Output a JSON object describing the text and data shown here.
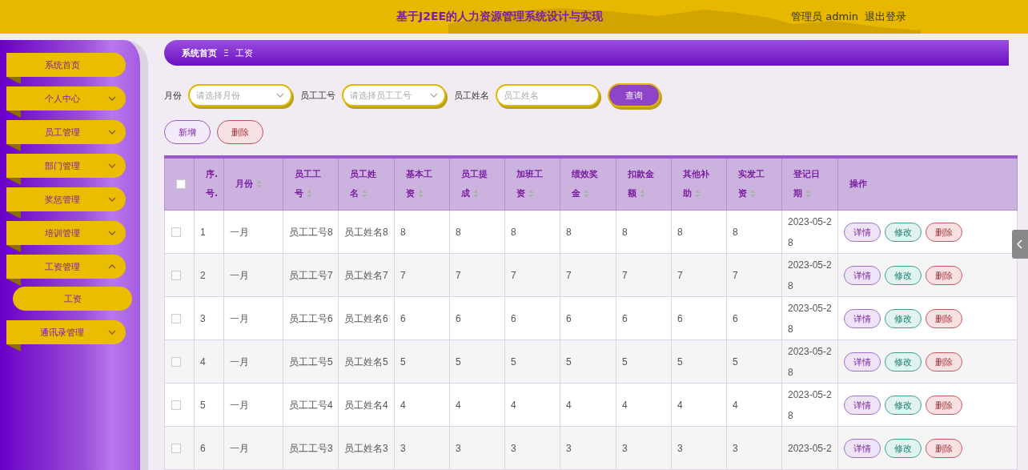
{
  "header": {
    "title": "基于J2EE的人力资源管理系统设计与实现",
    "user": "管理员 admin",
    "logout": "退出登录"
  },
  "sidebar": {
    "items": [
      {
        "label": "系统首页",
        "kind": "link"
      },
      {
        "label": "个人中心",
        "kind": "group",
        "expanded": false
      },
      {
        "label": "员工管理",
        "kind": "group",
        "expanded": false
      },
      {
        "label": "部门管理",
        "kind": "group",
        "expanded": false
      },
      {
        "label": "奖惩管理",
        "kind": "group",
        "expanded": false
      },
      {
        "label": "培训管理",
        "kind": "group",
        "expanded": false
      },
      {
        "label": "工资管理",
        "kind": "group",
        "expanded": true,
        "children": [
          {
            "label": "工资",
            "selected": true
          }
        ]
      },
      {
        "label": "通讯录管理",
        "kind": "group",
        "expanded": false
      }
    ]
  },
  "breadcrumb": [
    "系统首页",
    "工资"
  ],
  "breadcrumb_separator": "Ξ",
  "filters": [
    {
      "label": "月份",
      "placeholder": "请选择月份",
      "kind": "select"
    },
    {
      "label": "员工工号",
      "placeholder": "请选择员工工号",
      "kind": "select"
    },
    {
      "label": "员工姓名",
      "placeholder": "员工姓名",
      "kind": "text"
    }
  ],
  "query_button": "查询",
  "toolbar": [
    {
      "label": "新增",
      "kind": "add"
    },
    {
      "label": "删除",
      "kind": "delete"
    }
  ],
  "table": {
    "select_all": {
      "checked": false
    },
    "columns": [
      {
        "label": "序.号.",
        "sortable": false
      },
      {
        "label": "月份",
        "sortable": true
      },
      {
        "label": "员工工号",
        "sortable": true
      },
      {
        "label": "员工姓名",
        "sortable": true
      },
      {
        "label": "基本工资",
        "sortable": true
      },
      {
        "label": "员工提成",
        "sortable": true
      },
      {
        "label": "加班工资",
        "sortable": true
      },
      {
        "label": "绩效奖金",
        "sortable": true
      },
      {
        "label": "扣款金额",
        "sortable": true
      },
      {
        "label": "其他补助",
        "sortable": true
      },
      {
        "label": "实发工资",
        "sortable": true
      },
      {
        "label": "登记日期",
        "sortable": true
      },
      {
        "label": "操作",
        "sortable": false
      }
    ],
    "rows": [
      {
        "checked": false,
        "cells": [
          "1",
          "一月",
          "员工工号8",
          "员工姓名8",
          "8",
          "8",
          "8",
          "8",
          "8",
          "8",
          "8",
          "2023-05-28"
        ],
        "actions": [
          {
            "label": "详情",
            "kind": "detail"
          },
          {
            "label": "修改",
            "kind": "edit"
          },
          {
            "label": "删除",
            "kind": "delete"
          }
        ]
      },
      {
        "checked": false,
        "cells": [
          "2",
          "一月",
          "员工工号7",
          "员工姓名7",
          "7",
          "7",
          "7",
          "7",
          "7",
          "7",
          "7",
          "2023-05-28"
        ],
        "actions": [
          {
            "label": "详情",
            "kind": "detail"
          },
          {
            "label": "修改",
            "kind": "edit"
          },
          {
            "label": "删除",
            "kind": "delete"
          }
        ]
      },
      {
        "checked": false,
        "cells": [
          "3",
          "一月",
          "员工工号6",
          "员工姓名6",
          "6",
          "6",
          "6",
          "6",
          "6",
          "6",
          "6",
          "2023-05-28"
        ],
        "actions": [
          {
            "label": "详情",
            "kind": "detail"
          },
          {
            "label": "修改",
            "kind": "edit"
          },
          {
            "label": "删除",
            "kind": "delete"
          }
        ]
      },
      {
        "checked": false,
        "cells": [
          "4",
          "一月",
          "员工工号5",
          "员工姓名5",
          "5",
          "5",
          "5",
          "5",
          "5",
          "5",
          "5",
          "2023-05-28"
        ],
        "actions": [
          {
            "label": "详情",
            "kind": "detail"
          },
          {
            "label": "修改",
            "kind": "edit"
          },
          {
            "label": "删除",
            "kind": "delete"
          }
        ]
      },
      {
        "checked": false,
        "cells": [
          "5",
          "一月",
          "员工工号4",
          "员工姓名4",
          "4",
          "4",
          "4",
          "4",
          "4",
          "4",
          "4",
          "2023-05-28"
        ],
        "actions": [
          {
            "label": "详情",
            "kind": "detail"
          },
          {
            "label": "修改",
            "kind": "edit"
          },
          {
            "label": "删除",
            "kind": "delete"
          }
        ]
      },
      {
        "checked": false,
        "cells": [
          "6",
          "一月",
          "员工工号3",
          "员工姓名3",
          "3",
          "3",
          "3",
          "3",
          "3",
          "3",
          "3",
          "2023-05-2"
        ],
        "actions": [
          {
            "label": "详情",
            "kind": "detail"
          },
          {
            "label": "修改",
            "kind": "edit"
          },
          {
            "label": "删除",
            "kind": "delete"
          }
        ]
      }
    ]
  }
}
